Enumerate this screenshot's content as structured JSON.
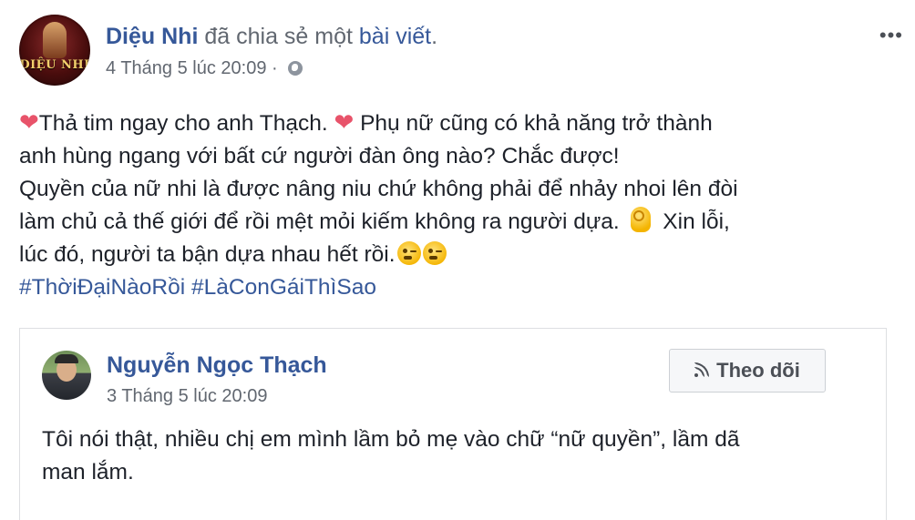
{
  "post": {
    "author": "Diệu Nhi",
    "action": " đã chia sẻ một ",
    "shared_object": "bài viết",
    "period": ".",
    "timestamp": "4 Tháng 5 lúc 20:09",
    "separator": " · ",
    "privacy_icon": "globe-icon",
    "more_icon": "more-options-icon",
    "avatar_logo": "DIỆU NHI",
    "body": {
      "line1_a": "Thả tim ngay cho anh Thạch. ",
      "line1_b": " Phụ nữ cũng có khả năng trở thành",
      "line2": "anh hùng ngang với bất cứ người đàn ông nào? Chắc được!",
      "line3": "Quyền của nữ nhi là được nâng niu chứ không phải để nhảy nhoi lên đòi",
      "line4_a": "làm chủ cả thế giới để rồi mệt mỏi kiếm không ra người dựa. ",
      "line4_b": " Xin lỗi,",
      "line5": "lúc đó, người ta bận dựa nhau hết rồi.",
      "heart": "❤"
    },
    "hashtags": [
      "#ThờiĐạiNàoRồi",
      "#LàConGáiThìSao"
    ]
  },
  "shared": {
    "author": "Nguyễn Ngọc Thạch",
    "timestamp": "3 Tháng 5 lúc 20:09",
    "follow_label": "Theo dõi",
    "follow_icon": "rss-icon",
    "text_line1": "Tôi nói thật, nhiều chị em mình lầm bỏ mẹ vào chữ “nữ quyền”, lầm dã",
    "text_line2": "man lắm."
  },
  "colors": {
    "link": "#365899",
    "secondary": "#616770",
    "text": "#1d2129",
    "heart": "#e8536a",
    "border": "#dddfe2"
  }
}
